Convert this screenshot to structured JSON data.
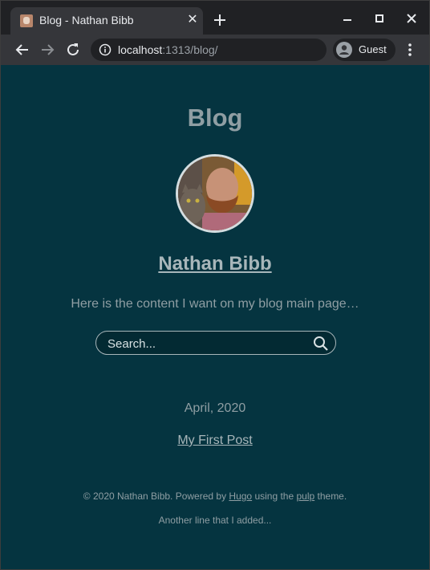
{
  "browser": {
    "tab_title": "Blog - Nathan Bibb",
    "tab_close": "✕",
    "url_host": "localhost",
    "url_path": ":1313/blog/",
    "profile_label": "Guest"
  },
  "page": {
    "title": "Blog",
    "author_name": "Nathan Bibb",
    "intro": "Here is the content I want on my blog main page…",
    "search_placeholder": "Search...",
    "archive_month": "April, 2020",
    "post_title": "My First Post",
    "footer": {
      "prefix": "© 2020 Nathan Bibb. Powered by ",
      "hugo_link": "Hugo",
      "middle": " using the ",
      "theme_link": "pulp",
      "suffix": " theme.",
      "extra_line": "Another line that I added..."
    }
  },
  "colors": {
    "page_background": "#053440",
    "chrome_dark": "#202124",
    "chrome_toolbar": "#35363a",
    "muted_text": "#8f9ea3",
    "link_text": "#a8b6ba"
  }
}
